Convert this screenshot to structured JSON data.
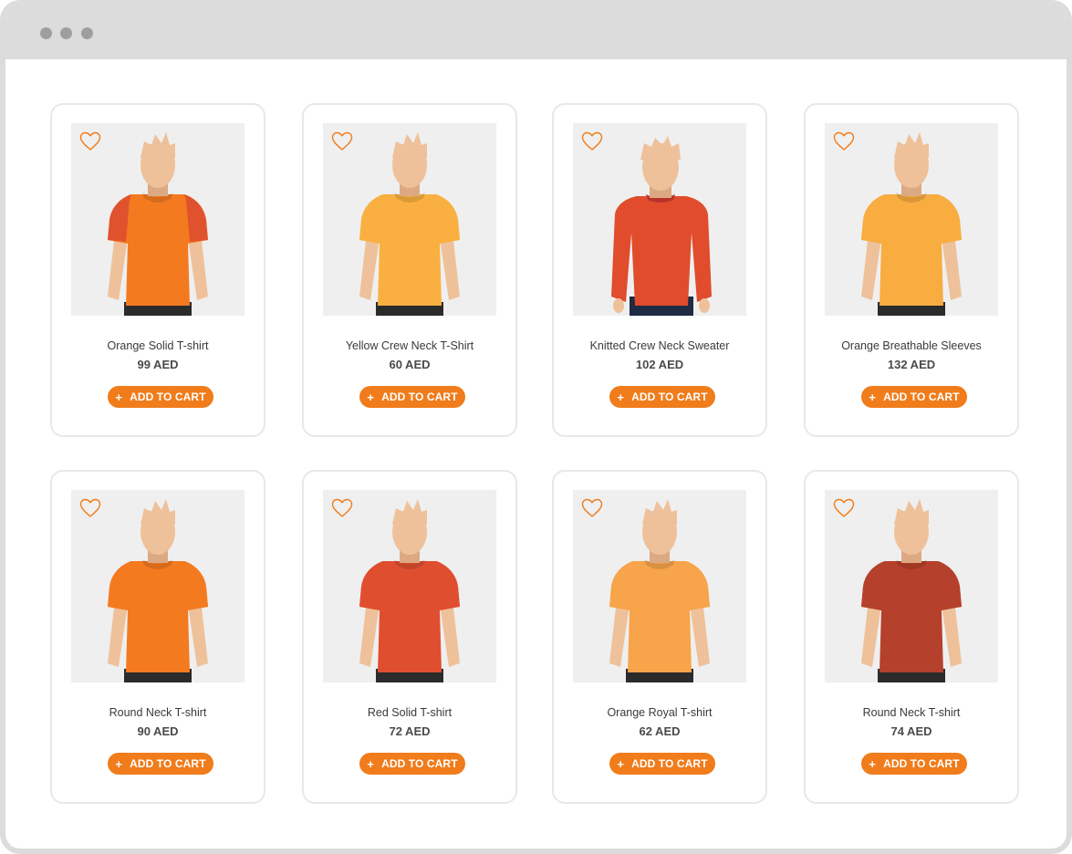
{
  "window": {
    "controls": [
      "close-dot",
      "minimize-dot",
      "maximize-dot"
    ]
  },
  "products": [
    {
      "name": "Orange Solid T-shirt",
      "price": "99 AED",
      "cta": "ADD TO CART",
      "shirt_color": "#f47a20",
      "sleeve_color": "#e0522e",
      "style": "tee"
    },
    {
      "name": "Yellow Crew Neck T-Shirt",
      "price": "60 AED",
      "cta": "ADD TO CART",
      "shirt_color": "#f9b040",
      "sleeve_color": "#f9b040",
      "style": "tee"
    },
    {
      "name": "Knitted Crew Neck Sweater",
      "price": "102 AED",
      "cta": "ADD TO CART",
      "shirt_color": "#e04c2c",
      "sleeve_color": "#e04c2c",
      "style": "sweater"
    },
    {
      "name": "Orange Breathable Sleeves",
      "price": "132 AED",
      "cta": "ADD TO CART",
      "shirt_color": "#f9ac40",
      "sleeve_color": "#f9ac40",
      "style": "tee"
    },
    {
      "name": "Round Neck T-shirt",
      "price": "90 AED",
      "cta": "ADD TO CART",
      "shirt_color": "#f47a20",
      "sleeve_color": "#f47a20",
      "style": "tee"
    },
    {
      "name": "Red Solid T-shirt",
      "price": "72 AED",
      "cta": "ADD TO CART",
      "shirt_color": "#e04e30",
      "sleeve_color": "#e04e30",
      "style": "tee"
    },
    {
      "name": "Orange  Royal T-shirt",
      "price": "62 AED",
      "cta": "ADD TO CART",
      "shirt_color": "#f7a44a",
      "sleeve_color": "#f7a44a",
      "style": "tee"
    },
    {
      "name": "Round Neck T-shirt",
      "price": "74 AED",
      "cta": "ADD TO CART",
      "shirt_color": "#b5402b",
      "sleeve_color": "#b5402b",
      "style": "tee"
    }
  ],
  "colors": {
    "accent": "#f07c1b",
    "heart": "#f07c1b",
    "card_border": "#e8e8e8",
    "thumb_bg": "#efefef",
    "skin": "#eec19a"
  }
}
